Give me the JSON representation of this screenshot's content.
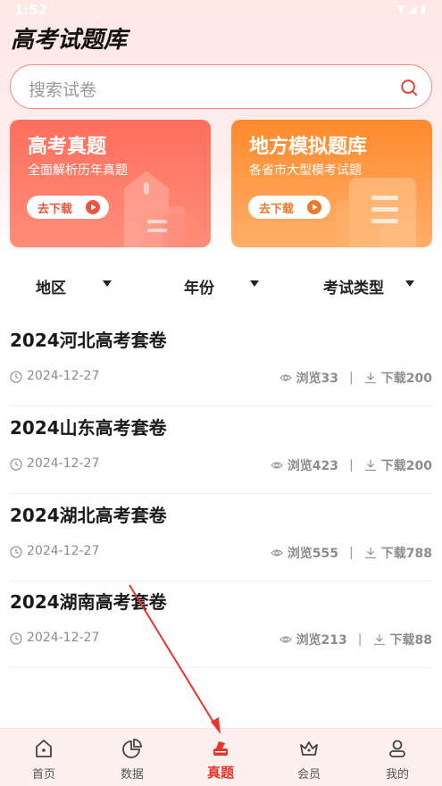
{
  "status_bar": {
    "time": "1:52"
  },
  "app": {
    "title": "高考试题库"
  },
  "search": {
    "placeholder": "搜索试卷"
  },
  "banners": [
    {
      "title": "高考真题",
      "subtitle": "全面解析历年真题",
      "button": "去下载"
    },
    {
      "title": "地方模拟题库",
      "subtitle": "各省市大型模考试题",
      "button": "去下载"
    }
  ],
  "filters": [
    {
      "label": "地区"
    },
    {
      "label": "年份"
    },
    {
      "label": "考试类型"
    }
  ],
  "exams": [
    {
      "title": "2024河北高考套卷",
      "date": "2024-12-27",
      "views": "浏览33",
      "downloads": "下载200"
    },
    {
      "title": "2024山东高考套卷",
      "date": "2024-12-27",
      "views": "浏览423",
      "downloads": "下载200"
    },
    {
      "title": "2024湖北高考套卷",
      "date": "2024-12-27",
      "views": "浏览555",
      "downloads": "下载788"
    },
    {
      "title": "2024湖南高考套卷",
      "date": "2024-12-27",
      "views": "浏览213",
      "downloads": "下载88"
    }
  ],
  "stat_separator": "|",
  "tabs": [
    {
      "label": "首页",
      "icon": "home-icon"
    },
    {
      "label": "数据",
      "icon": "chart-icon"
    },
    {
      "label": "真题",
      "icon": "brush-icon",
      "active": true
    },
    {
      "label": "会员",
      "icon": "crown-icon"
    },
    {
      "label": "我的",
      "icon": "user-icon"
    }
  ],
  "colors": {
    "accent": "#e8342a",
    "card1": "#ff6e5c",
    "card2": "#ff8a2c",
    "search_border": "#f08a84"
  }
}
